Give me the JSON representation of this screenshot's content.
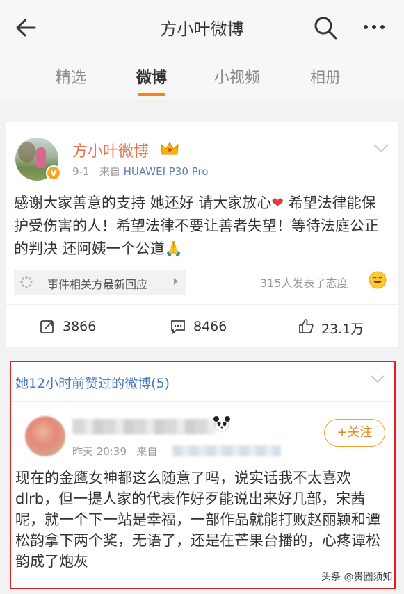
{
  "header": {
    "title": "方小叶微博"
  },
  "tabs": [
    {
      "label": "精选"
    },
    {
      "label": "微博"
    },
    {
      "label": "小视频"
    },
    {
      "label": "相册"
    }
  ],
  "post": {
    "author": "方小叶微博",
    "date": "9-1",
    "source_prefix": "来自",
    "source": "HUAWEI P30 Pro",
    "content": "感谢大家善意的支持 她还好 请大家放心",
    "content_heart": "❤",
    "content_rest": " 希望法律能保护受伤害的人！希望法律不要让善者失望！等待法庭公正的判决 还阿姨一个公道🙏",
    "topic_label": "事件相关方最新回应",
    "attitude_text": "315人发表了态度",
    "repost_count": "3866",
    "comment_count": "8466",
    "like_count": "23.1万"
  },
  "liked": {
    "heading": "她12小时前赞过的微博(5)",
    "time": "昨天 20:39",
    "source_prefix": "来自",
    "follow_label": "+关注",
    "content": "现在的金鹰女神都这么随意了吗，说实话我不太喜欢dlrb，但一提人家的代表作好歹能说出来好几部，宋茜呢，就一个下一站是幸福，一部作品就能打败赵丽颖和谭松韵拿下两个奖，无语了，还是在芒果台播的，心疼谭松韵成了炮灰"
  },
  "watermark": "头条 @贵圈须知",
  "colors": {
    "accent": "#ff8200",
    "username": "#eb7350",
    "link": "#4a7bbf",
    "highlight_border": "#e02020"
  }
}
